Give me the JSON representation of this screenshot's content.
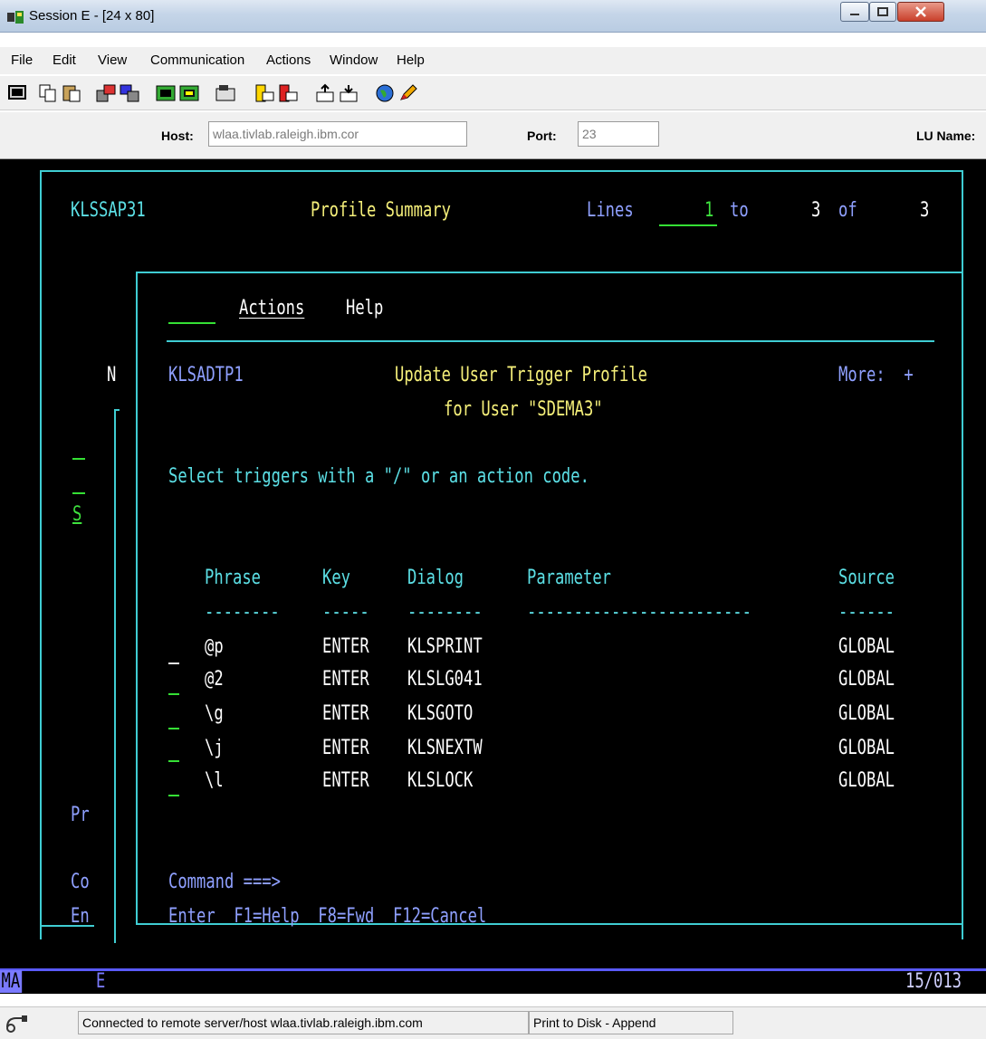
{
  "window": {
    "title": "Session E - [24 x 80]"
  },
  "menu": [
    "File",
    "Edit",
    "View",
    "Communication",
    "Actions",
    "Window",
    "Help"
  ],
  "toolbar": {
    "icons": [
      "display-icon",
      "copy-icon",
      "paste-icon",
      "send-icon",
      "receive-icon",
      "keyboard-icon",
      "macro-icon",
      "record-icon",
      "play-icon",
      "stop-icon",
      "transfer-to-icon",
      "transfer-from-icon",
      "web-icon",
      "edit-icon"
    ]
  },
  "host": {
    "host_label": "Host:",
    "host_value": "wlaa.tivlab.raleigh.ibm.cor",
    "port_label": "Port:",
    "port_value": "23",
    "lu_label": "LU Name:"
  },
  "terminal": {
    "panel_id": "KLSSAP31",
    "panel_title": "Profile Summary",
    "lines_label": "Lines",
    "lines_from": "1",
    "lines_to_label": "to",
    "lines_to": "3",
    "of_label": "of",
    "lines_total": "3",
    "bg_n": "N",
    "bg_s": "S",
    "bg_pr": "Pr",
    "bg_co": "Co",
    "bg_en": "En",
    "popup": {
      "menu_actions": "Actions",
      "menu_help": "Help",
      "id": "KLSADTP1",
      "title1": "Update User Trigger Profile",
      "title2": "for User \"SDEMA3\"",
      "more": "More:  +",
      "instruction": "Select triggers with a \"/\" or an action code.",
      "headers": {
        "phrase": "Phrase",
        "key": "Key",
        "dialog": "Dialog",
        "parameter": "Parameter",
        "source": "Source"
      },
      "dashes": {
        "phrase": "--------",
        "key": "-----",
        "dialog": "--------",
        "parameter": "------------------------",
        "source": "------"
      },
      "rows": [
        {
          "phrase": "@p",
          "key": "ENTER",
          "dialog": "KLSPRINT",
          "source": "GLOBAL"
        },
        {
          "phrase": "@2",
          "key": "ENTER",
          "dialog": "KLSLG041",
          "source": "GLOBAL"
        },
        {
          "phrase": "\\g",
          "key": "ENTER",
          "dialog": "KLSGOTO",
          "source": "GLOBAL"
        },
        {
          "phrase": "\\j",
          "key": "ENTER",
          "dialog": "KLSNEXTW",
          "source": "GLOBAL"
        },
        {
          "phrase": "\\l",
          "key": "ENTER",
          "dialog": "KLSLOCK",
          "source": "GLOBAL"
        }
      ],
      "command_label": "Command ===>",
      "fkeys": "Enter  F1=Help  F8=Fwd  F12=Cancel"
    }
  },
  "oia": {
    "left": "MA",
    "mode": "E",
    "position": "15/013"
  },
  "statusbar": {
    "connection": "Connected to remote server/host wlaa.tivlab.raleigh.ibm.com",
    "print": "Print to Disk - Append"
  }
}
